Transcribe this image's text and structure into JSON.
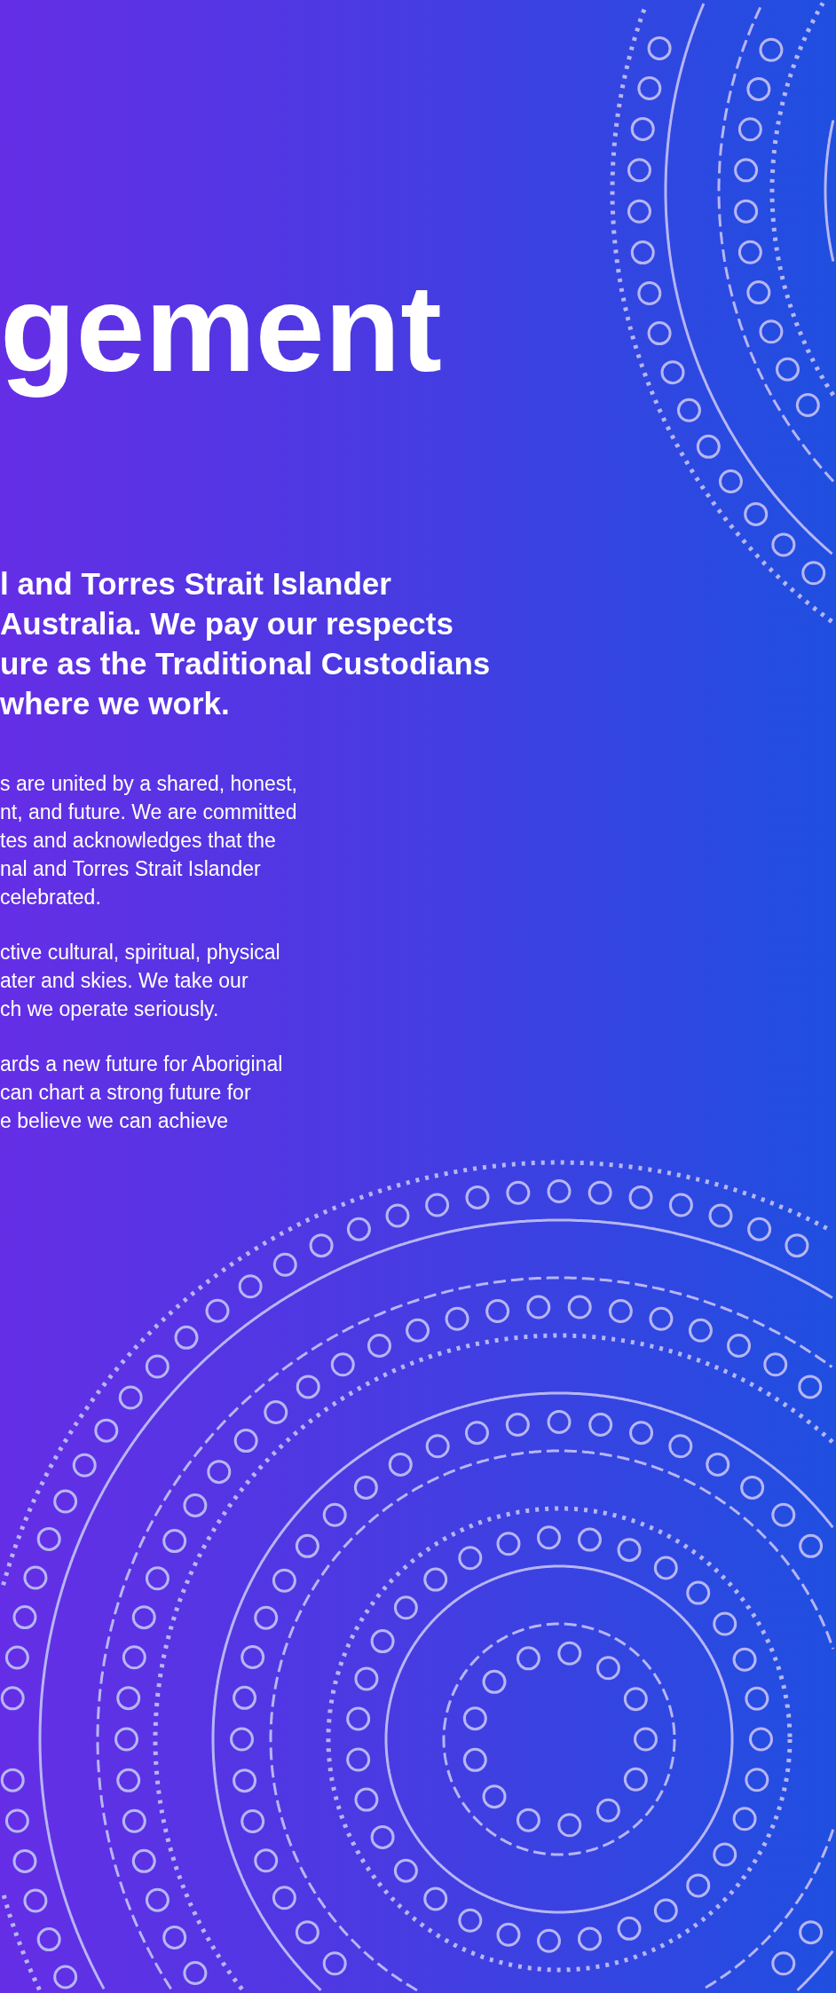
{
  "title": "gement",
  "lead": [
    "l and Torres Strait Islander",
    "Australia. We pay our respects",
    "ure as the Traditional Custodians",
    "where we work."
  ],
  "paragraphs": [
    [
      "s are united by a shared, honest,",
      "nt, and future. We are committed",
      "tes and acknowledges that the",
      "nal and Torres Strait Islander",
      "celebrated."
    ],
    [
      "ctive cultural, spiritual, physical",
      "ater and skies.  We take our",
      "ch we operate seriously."
    ],
    [
      "ards a new future for Aboriginal",
      "can chart a strong future for",
      "e believe we can achieve"
    ]
  ]
}
